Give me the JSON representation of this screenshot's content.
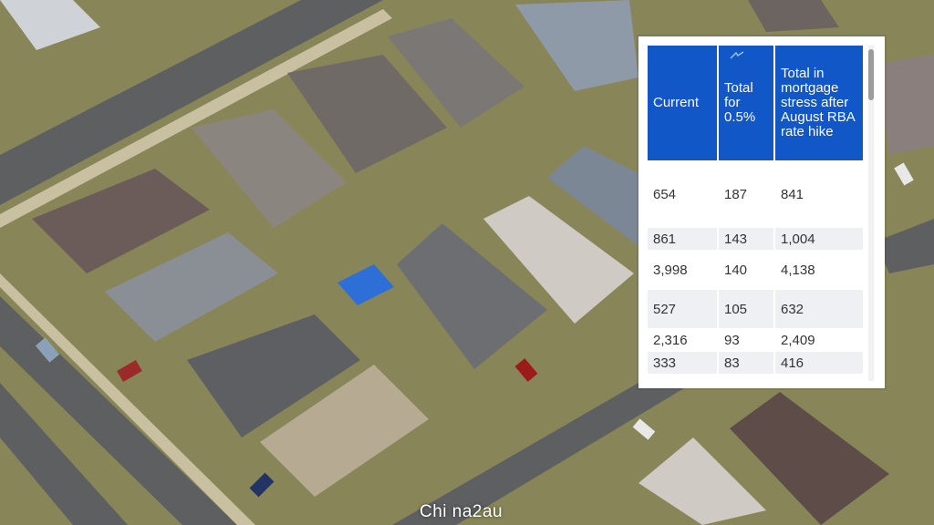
{
  "table": {
    "headers": [
      "Current",
      "Total for 0.5%",
      "Total in mortgage stress after August RBA rate hike"
    ],
    "rows": [
      {
        "current": "654",
        "total_05": "187",
        "after_hike": "841"
      },
      {
        "current": "861",
        "total_05": "143",
        "after_hike": "1,004"
      },
      {
        "current": "3,998",
        "total_05": "140",
        "after_hike": "4,138"
      },
      {
        "current": "527",
        "total_05": "105",
        "after_hike": "632"
      },
      {
        "current": "2,316",
        "total_05": "93",
        "after_hike": "2,409"
      },
      {
        "current": "333",
        "total_05": "83",
        "after_hike": "416"
      }
    ]
  },
  "watermark": "Chi na2au",
  "colors": {
    "header_bg": "#1157c7",
    "alt_row": "#eef0f3"
  },
  "icons": [
    "sort-icon"
  ]
}
